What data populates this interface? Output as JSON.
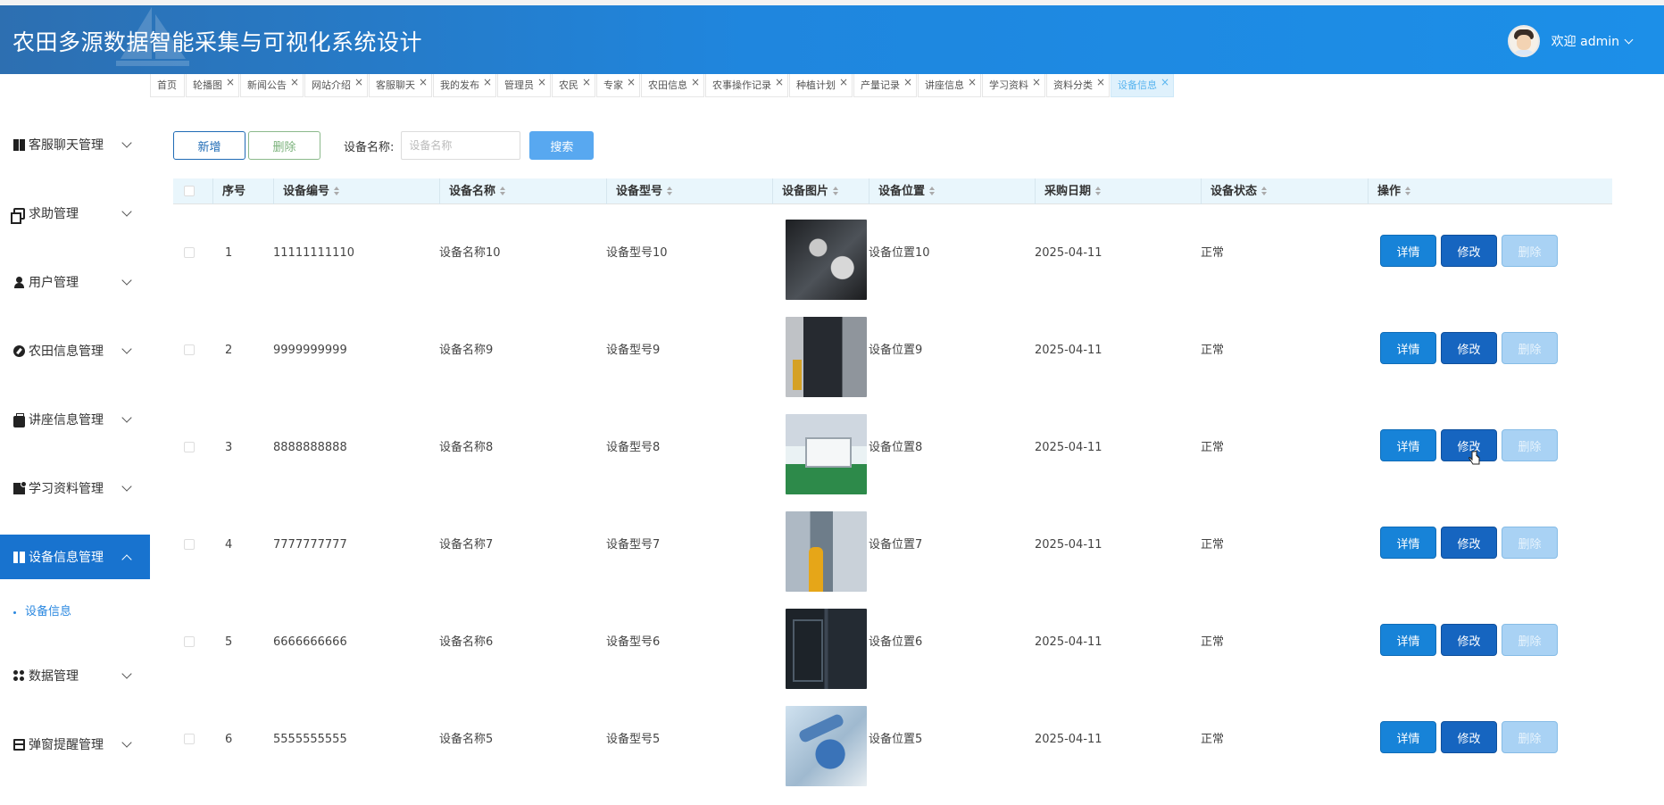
{
  "header": {
    "title": "农田多源数据智能采集与可视化系统设计",
    "user_label": "欢迎 admin"
  },
  "tabs": [
    {
      "label": "首页",
      "closable": false
    },
    {
      "label": "轮播图",
      "closable": true
    },
    {
      "label": "新闻公告",
      "closable": true
    },
    {
      "label": "网站介绍",
      "closable": true
    },
    {
      "label": "客服聊天",
      "closable": true
    },
    {
      "label": "我的发布",
      "closable": true
    },
    {
      "label": "管理员",
      "closable": true
    },
    {
      "label": "农民",
      "closable": true
    },
    {
      "label": "专家",
      "closable": true
    },
    {
      "label": "农田信息",
      "closable": true
    },
    {
      "label": "农事操作记录",
      "closable": true
    },
    {
      "label": "种植计划",
      "closable": true
    },
    {
      "label": "产量记录",
      "closable": true
    },
    {
      "label": "讲座信息",
      "closable": true
    },
    {
      "label": "学习资料",
      "closable": true
    },
    {
      "label": "资料分类",
      "closable": true
    },
    {
      "label": "设备信息",
      "closable": true,
      "active": true
    }
  ],
  "sidebar": {
    "items": [
      {
        "label": "客服聊天管理",
        "icon": "dashboard-icon"
      },
      {
        "label": "求助管理",
        "icon": "copy-icon"
      },
      {
        "label": "用户管理",
        "icon": "user-icon"
      },
      {
        "label": "农田信息管理",
        "icon": "compass-icon"
      },
      {
        "label": "讲座信息管理",
        "icon": "briefcase-icon"
      },
      {
        "label": "学习资料管理",
        "icon": "book-icon"
      },
      {
        "label": "设备信息管理",
        "icon": "panel-icon",
        "active": true
      },
      {
        "label": "数据管理",
        "icon": "grid-icon"
      },
      {
        "label": "弹窗提醒管理",
        "icon": "tray-icon"
      }
    ],
    "sub_item": "设备信息"
  },
  "toolbar": {
    "add_label": "新增",
    "delete_label": "删除",
    "search_label": "设备名称:",
    "search_placeholder": "设备名称",
    "search_button": "搜索"
  },
  "table": {
    "columns": [
      "序号",
      "设备编号",
      "设备名称",
      "设备型号",
      "设备图片",
      "设备位置",
      "采购日期",
      "设备状态",
      "操作"
    ],
    "rows": [
      {
        "index": "1",
        "code": "11111111110",
        "name": "设备名称10",
        "model": "设备型号10",
        "location": "设备位置10",
        "date": "2025-04-11",
        "status": "正常"
      },
      {
        "index": "2",
        "code": "9999999999",
        "name": "设备名称9",
        "model": "设备型号9",
        "location": "设备位置9",
        "date": "2025-04-11",
        "status": "正常"
      },
      {
        "index": "3",
        "code": "8888888888",
        "name": "设备名称8",
        "model": "设备型号8",
        "location": "设备位置8",
        "date": "2025-04-11",
        "status": "正常"
      },
      {
        "index": "4",
        "code": "7777777777",
        "name": "设备名称7",
        "model": "设备型号7",
        "location": "设备位置7",
        "date": "2025-04-11",
        "status": "正常"
      },
      {
        "index": "5",
        "code": "6666666666",
        "name": "设备名称6",
        "model": "设备型号6",
        "location": "设备位置6",
        "date": "2025-04-11",
        "status": "正常"
      },
      {
        "index": "6",
        "code": "5555555555",
        "name": "设备名称5",
        "model": "设备型号5",
        "location": "设备位置5",
        "date": "2025-04-11",
        "status": "正常"
      }
    ],
    "actions": {
      "detail": "详情",
      "edit": "修改",
      "delete": "删除"
    }
  },
  "colors": {
    "header_blue": "#1f86de",
    "active_menu": "#1873cf",
    "search_button": "#58a8f0"
  }
}
